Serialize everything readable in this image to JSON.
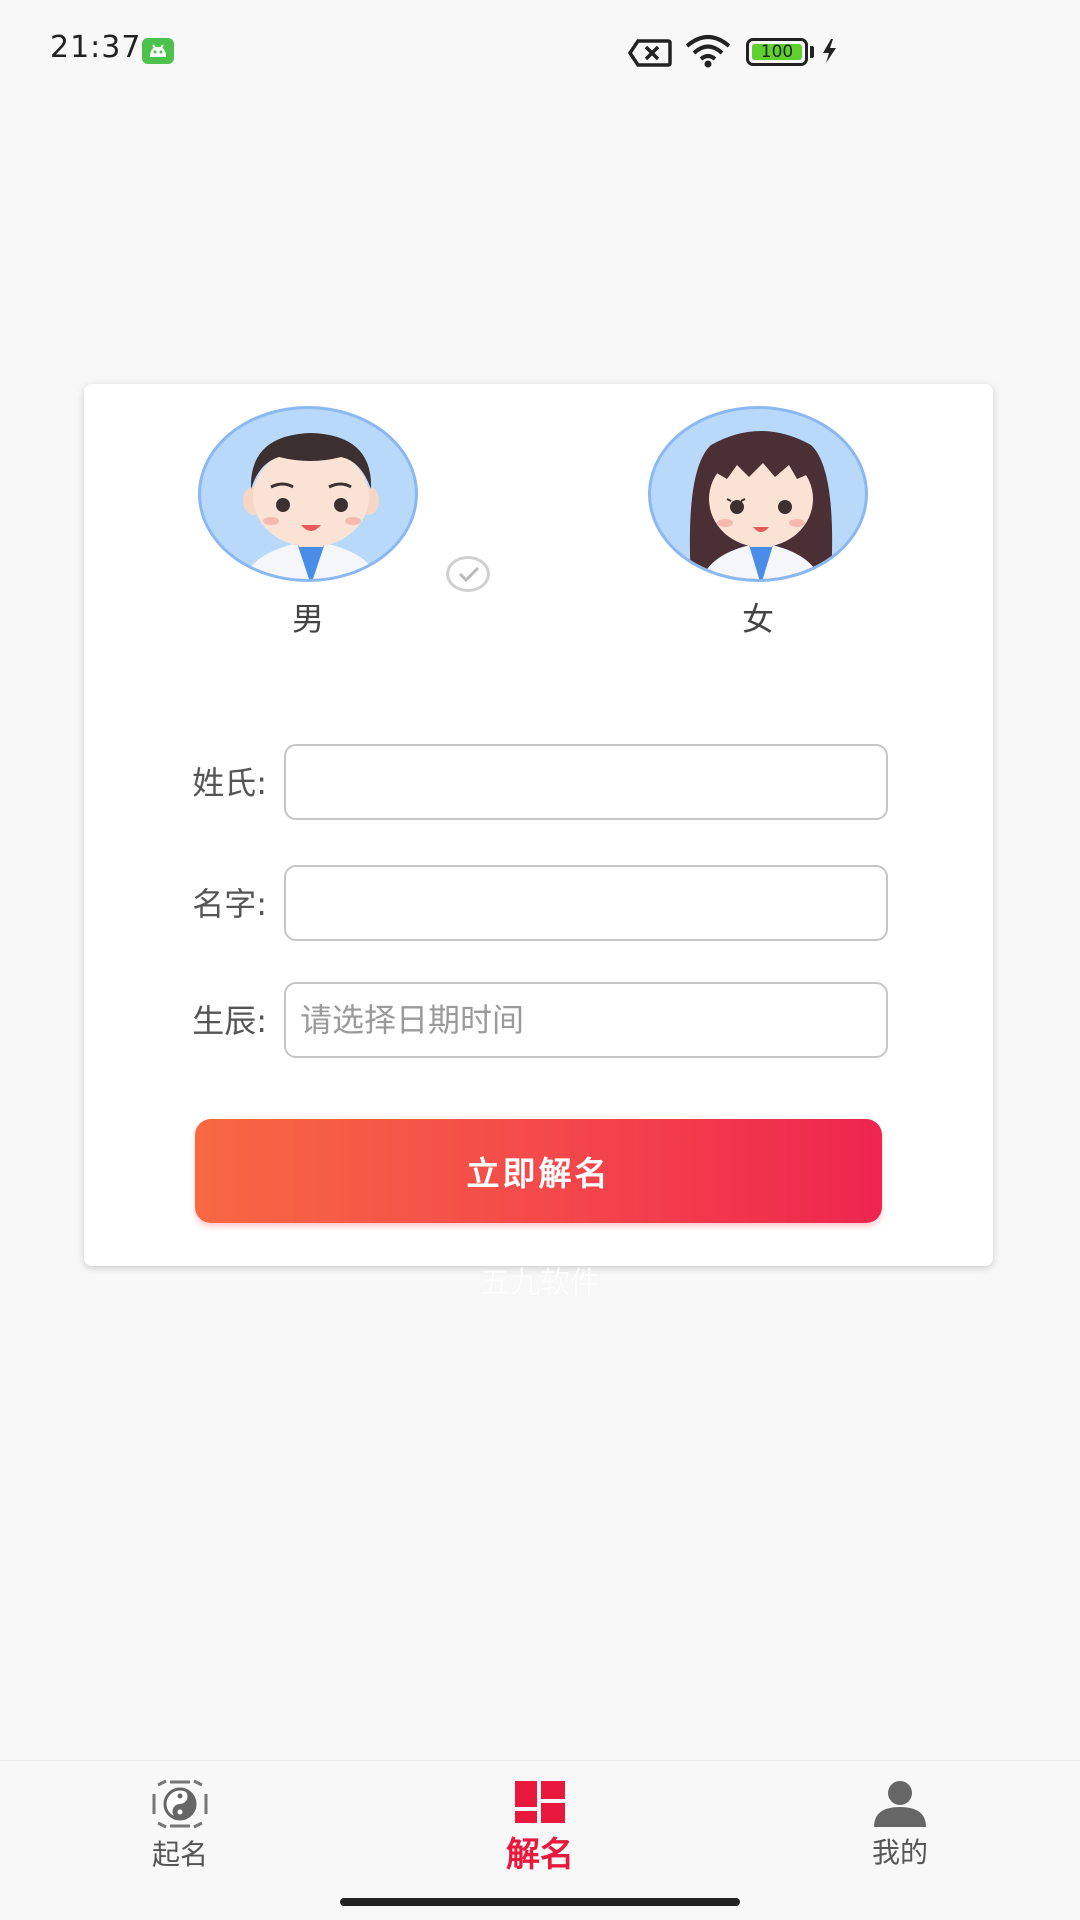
{
  "status_bar": {
    "time": "21:37",
    "battery": "100"
  },
  "gender": {
    "male_label": "男",
    "female_label": "女",
    "selected": "男"
  },
  "form": {
    "surname_label": "姓氏:",
    "surname_value": "",
    "name_label": "名字:",
    "name_value": "",
    "birth_label": "生辰:",
    "birth_placeholder": "请选择日期时间",
    "submit_label": "立即解名"
  },
  "watermark": "五九软件",
  "bottom_nav": {
    "items": [
      {
        "label": "起名",
        "icon": "bagua-icon",
        "active": false
      },
      {
        "label": "解名",
        "icon": "grid-icon",
        "active": true
      },
      {
        "label": "我的",
        "icon": "user-icon",
        "active": false
      }
    ]
  },
  "colors": {
    "accent": "#e8193c",
    "button_gradient_start": "#f76843",
    "button_gradient_end": "#ee254f",
    "avatar_bg": "#b9d9fb"
  }
}
